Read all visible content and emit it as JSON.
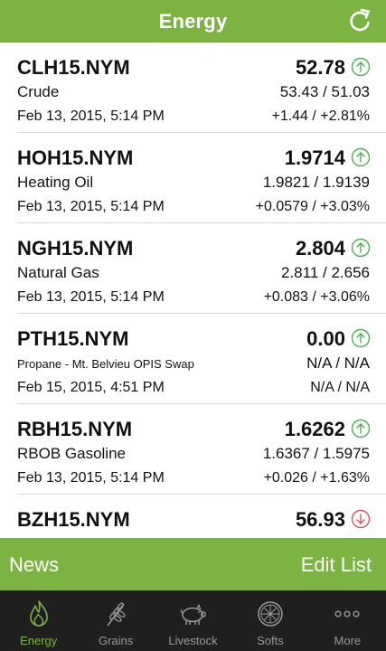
{
  "header": {
    "title": "Energy",
    "refresh_icon": "refresh-icon"
  },
  "colors": {
    "accent": "#7cb342",
    "up": "#4caf50",
    "down": "#d9534f",
    "tabbar": "#1f1f1f"
  },
  "quotes": [
    {
      "symbol": "CLH15.NYM",
      "name": "Crude",
      "last": "52.78",
      "direction": "up",
      "hilo": "53.43 / 51.03",
      "date": "Feb 13, 2015, 5:14 PM",
      "change": "+1.44 / +2.81%"
    },
    {
      "symbol": "HOH15.NYM",
      "name": "Heating Oil",
      "last": "1.9714",
      "direction": "up",
      "hilo": "1.9821 / 1.9139",
      "date": "Feb 13, 2015, 5:14 PM",
      "change": "+0.0579 / +3.03%"
    },
    {
      "symbol": "NGH15.NYM",
      "name": "Natural Gas",
      "last": "2.804",
      "direction": "up",
      "hilo": "2.811 / 2.656",
      "date": "Feb 13, 2015, 5:14 PM",
      "change": "+0.083 / +3.06%"
    },
    {
      "symbol": "PTH15.NYM",
      "name": "Propane - Mt. Belvieu OPIS Swap",
      "last": "0.00",
      "direction": "up",
      "hilo": "N/A / N/A",
      "date": "Feb 15, 2015, 4:51 PM",
      "change": "N/A / N/A"
    },
    {
      "symbol": "RBH15.NYM",
      "name": "RBOB Gasoline",
      "last": "1.6262",
      "direction": "up",
      "hilo": "1.6367 / 1.5975",
      "date": "Feb 13, 2015, 5:14 PM",
      "change": "+0.026 / +1.63%"
    },
    {
      "symbol": "BZH15.NYM",
      "name": "",
      "last": "56.93",
      "direction": "down",
      "hilo": "",
      "date": "",
      "change": ""
    }
  ],
  "actions": {
    "news": "News",
    "edit_list": "Edit List"
  },
  "tabs": [
    {
      "label": "Energy",
      "icon": "flame-icon",
      "active": true
    },
    {
      "label": "Grains",
      "icon": "wheat-icon",
      "active": false
    },
    {
      "label": "Livestock",
      "icon": "pig-icon",
      "active": false
    },
    {
      "label": "Softs",
      "icon": "orange-slice-icon",
      "active": false
    },
    {
      "label": "More",
      "icon": "more-dots-icon",
      "active": false
    }
  ]
}
